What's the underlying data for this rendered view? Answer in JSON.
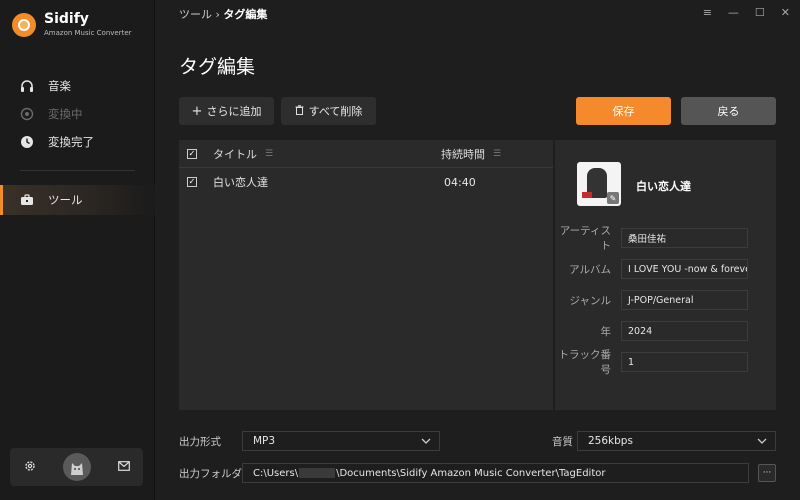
{
  "app": {
    "name": "Sidify",
    "subtitle": "Amazon Music Converter",
    "accent": "#f58a2c"
  },
  "sidebar": {
    "items": [
      {
        "label": "音楽",
        "icon": "headphones-icon",
        "state": "normal"
      },
      {
        "label": "変換中",
        "icon": "converting-icon",
        "state": "disabled"
      },
      {
        "label": "変換完了",
        "icon": "clock-icon",
        "state": "normal"
      },
      {
        "label": "ツール",
        "icon": "toolbox-icon",
        "state": "active"
      }
    ],
    "bottom": {
      "settings_icon": "gear-icon",
      "avatar_icon": "avatar-icon",
      "mail_icon": "mail-icon"
    }
  },
  "header": {
    "breadcrumb_parent": "ツール",
    "breadcrumb_sep": "›",
    "breadcrumb_current": "タグ編集",
    "window_controls": [
      "≡",
      "—",
      "☐",
      "✕"
    ]
  },
  "page": {
    "title": "タグ編集"
  },
  "toolbar": {
    "add_label": "さらに追加",
    "delete_all_label": "すべて削除",
    "save_label": "保存",
    "back_label": "戻る"
  },
  "track_list": {
    "columns": {
      "title": "タイトル",
      "duration": "持続時間"
    },
    "rows": [
      {
        "checked": true,
        "title": "白い恋人達",
        "duration": "04:40"
      }
    ]
  },
  "detail": {
    "track_name": "白い恋人達",
    "fields": [
      {
        "label": "アーティスト",
        "value": "桑田佳祐"
      },
      {
        "label": "アルバム",
        "value": "I LOVE YOU -now & foreve"
      },
      {
        "label": "ジャンル",
        "value": "J-POP/General"
      },
      {
        "label": "年",
        "value": "2024"
      },
      {
        "label": "トラック番号",
        "value": "1"
      }
    ]
  },
  "output": {
    "format_label": "出力形式",
    "format_value": "MP3",
    "quality_label": "音質",
    "quality_value": "256kbps",
    "folder_label": "出力フォルダ",
    "folder_prefix": "C:\\Users\\",
    "folder_suffix": "\\Documents\\Sidify Amazon Music Converter\\TagEditor",
    "browse_label": "···"
  }
}
